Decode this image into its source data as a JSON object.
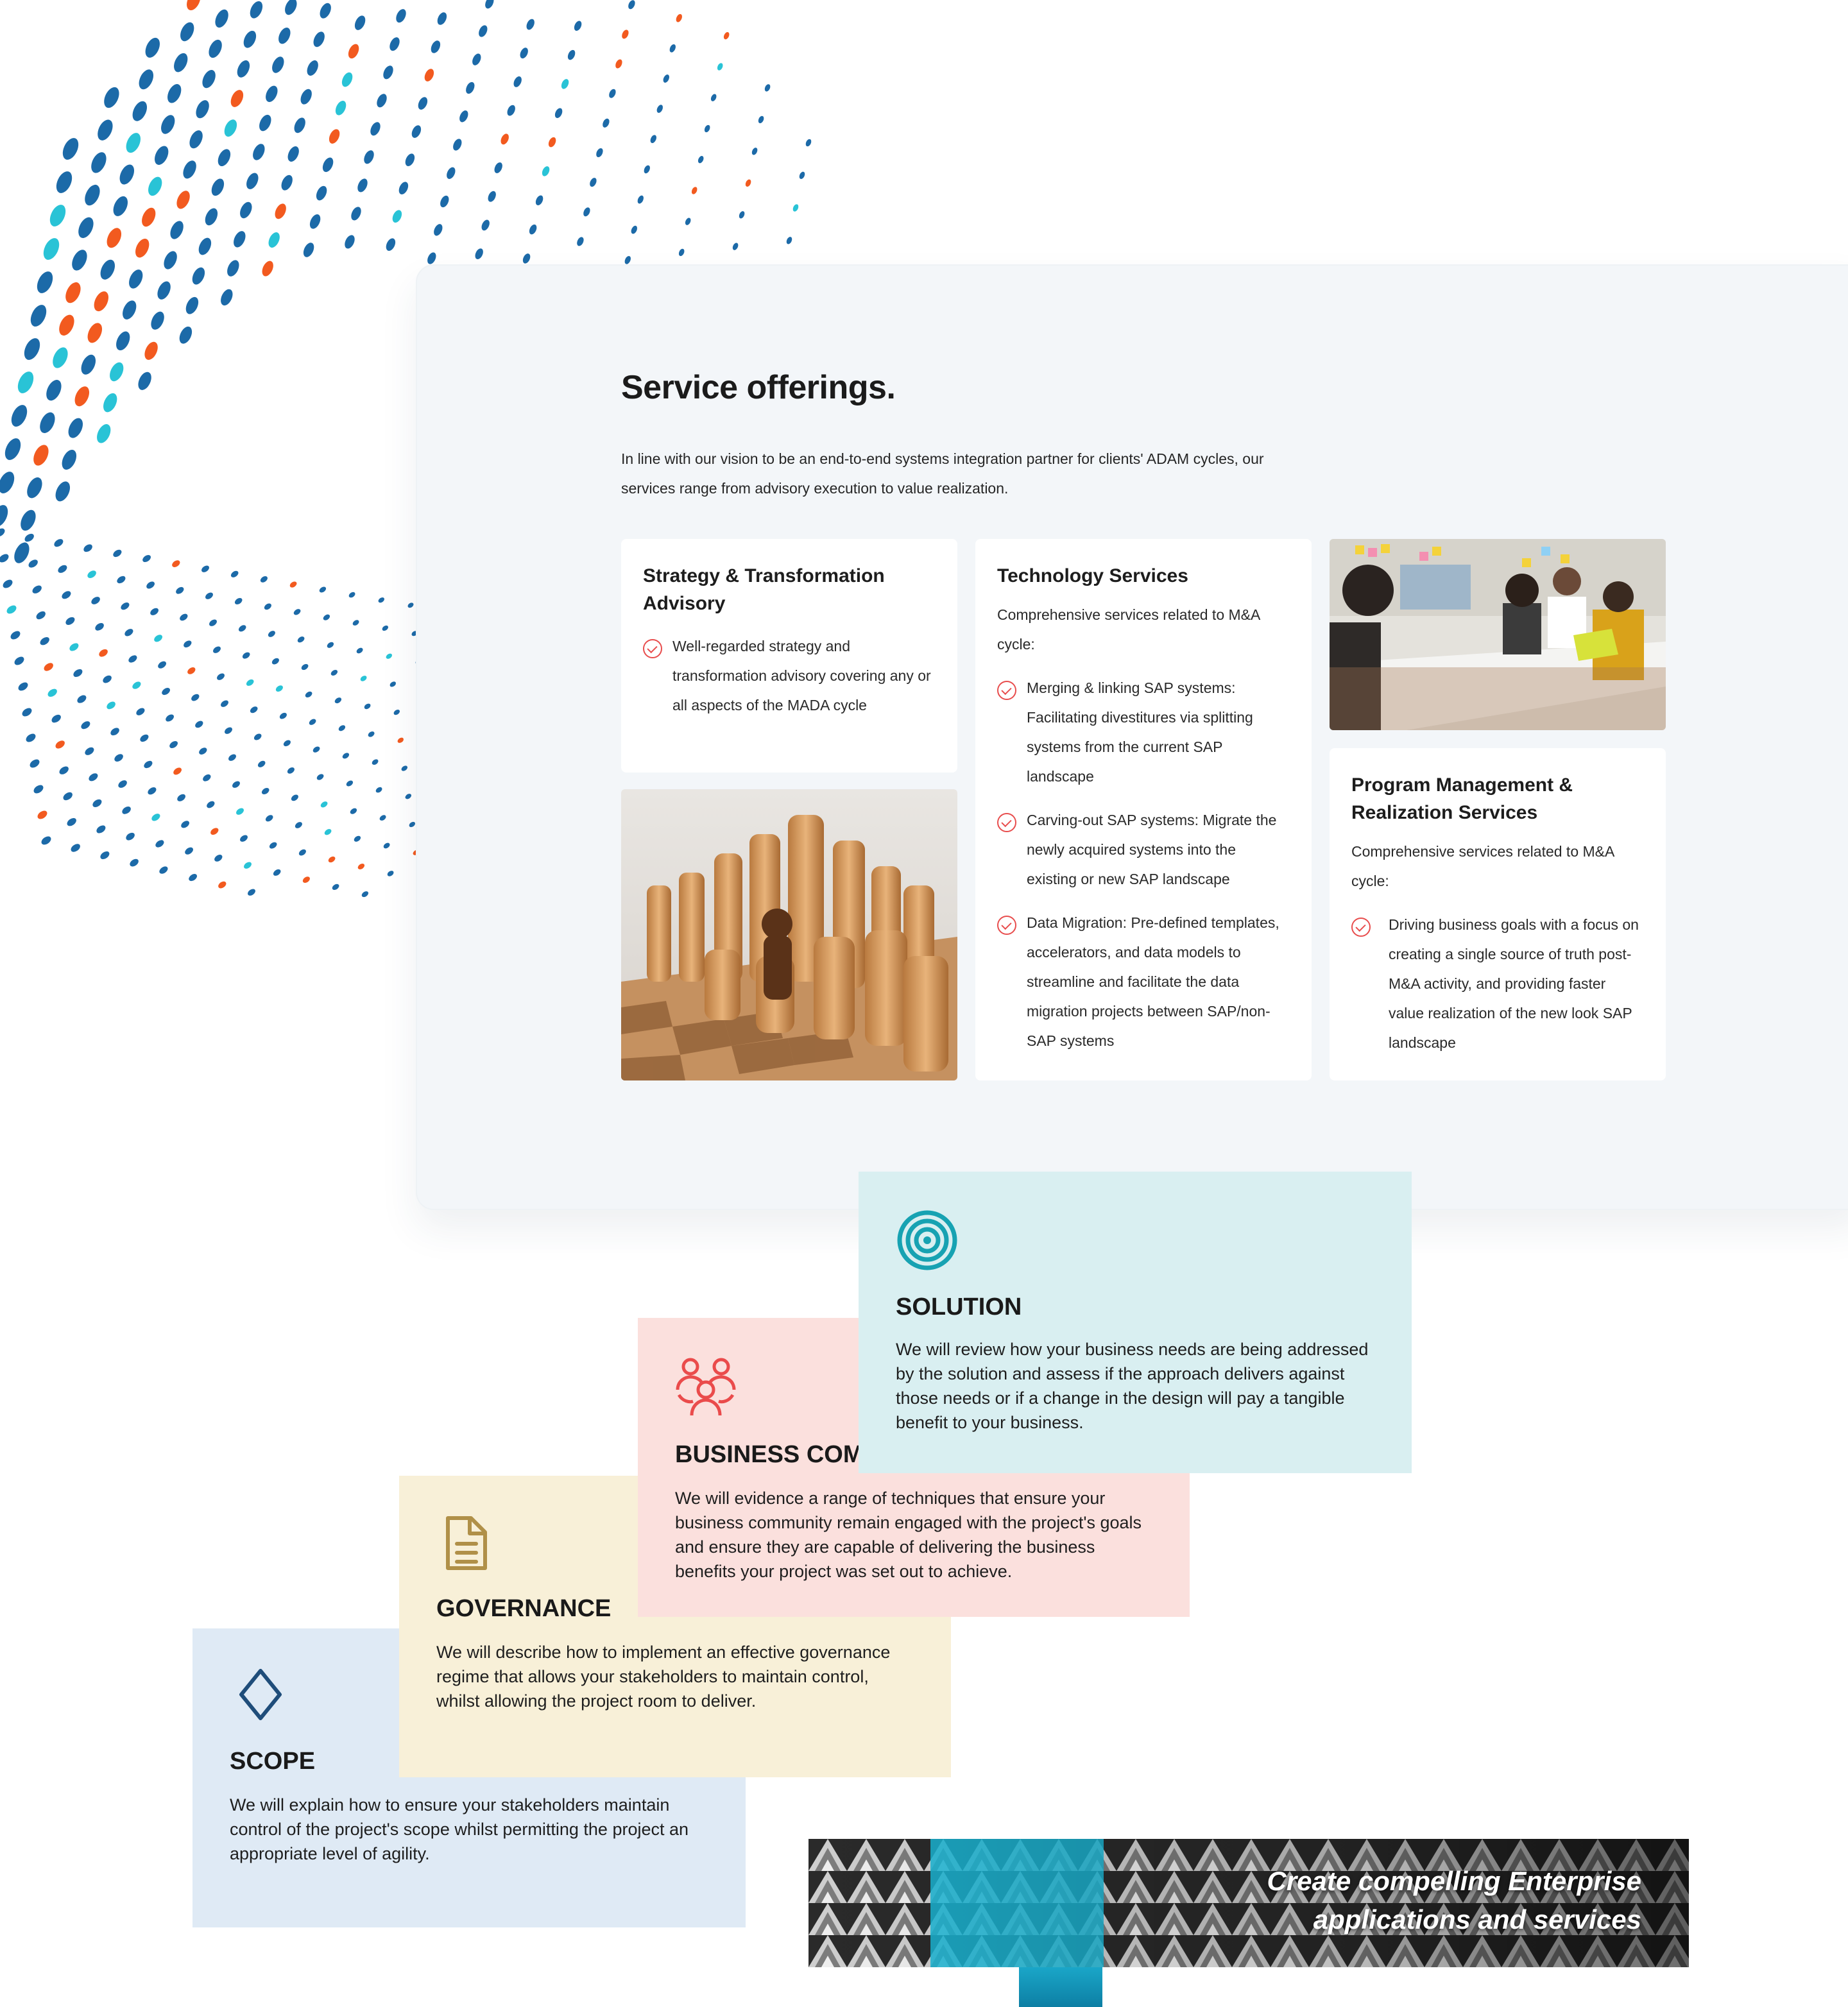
{
  "colors": {
    "accent_red": "#e84d4d",
    "dot_blue": "#1c6aa8",
    "dot_cyan": "#29c3d6",
    "dot_orange": "#f25a1f",
    "solution_bg": "#d9eff1",
    "business_bg": "#fbe0dd",
    "governance_bg": "#f8f0d8",
    "scope_bg": "#dfeaf5"
  },
  "services": {
    "title": "Service offerings.",
    "intro": "In line with our vision to be an end-to-end systems integration partner for clients' ADAM cycles, our services range from advisory execution to value realization.",
    "strategy": {
      "title": "Strategy & Transformation Advisory",
      "bullets": [
        "Well-regarded strategy and transformation advisory covering any or all aspects of the MADA cycle"
      ]
    },
    "technology": {
      "title": "Technology Services",
      "desc": "Comprehensive services related to M&A cycle:",
      "bullets": [
        "Merging & linking SAP systems: Facilitating divestitures via splitting systems from the current SAP landscape",
        "Carving-out SAP systems: Migrate the newly acquired systems into the existing or new SAP landscape",
        "Data Migration: Pre-defined templates, accelerators, and data models to streamline and facilitate the data migration projects between SAP/non-SAP systems"
      ]
    },
    "program": {
      "title": "Program Management & Realization Services",
      "desc": "Comprehensive services related to M&A cycle:",
      "bullets": [
        "Driving business goals with a focus on creating a single source of truth post-M&A activity, and providing faster value realization of the new look SAP landscape"
      ]
    }
  },
  "tiles": {
    "solution": {
      "icon": "target-icon",
      "title": "SOLUTION",
      "text": "We will review how your business needs are being addressed by the solution and assess if the approach delivers against those needs or if a change in the design will pay a tangible benefit to your business."
    },
    "business": {
      "icon": "community-icon",
      "title": "BUSINESS COMMUNITY",
      "text": "We will evidence a range of techniques that ensure your business community remain engaged with the project's goals and ensure they are capable of delivering the business benefits your project was set out to achieve."
    },
    "governance": {
      "icon": "document-icon",
      "title": "GOVERNANCE",
      "text": "We will describe how to implement an effective governance regime that allows your stakeholders to maintain control, whilst allowing the project room to deliver."
    },
    "scope": {
      "icon": "diamond-icon",
      "title": "SCOPE",
      "text": "We will explain how to ensure your stakeholders maintain control of the project's scope whilst permitting the project an appropriate level of agility."
    }
  },
  "banner": {
    "line1": "Create compelling Enterprise",
    "line2": "applications and services"
  }
}
